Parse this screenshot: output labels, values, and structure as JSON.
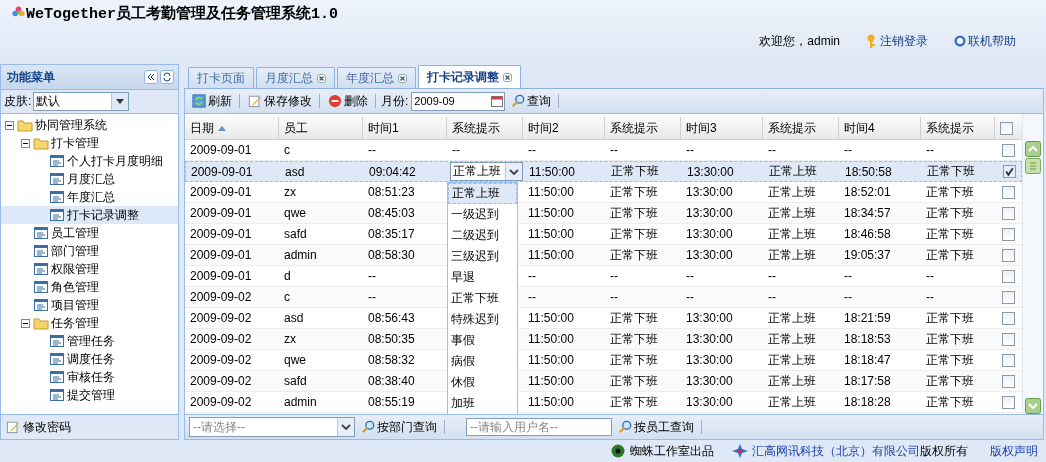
{
  "header": {
    "title": "WeTogether员工考勤管理及任务管理系统1.0",
    "welcome": "欢迎您，admin",
    "links": [
      "注销登录",
      "联机帮助"
    ]
  },
  "sidebar": {
    "title": "功能菜单",
    "skin_label": "皮肤:",
    "skin_value": "默认",
    "tree": [
      {
        "label": "协同管理系统",
        "expanded": true,
        "selected": false,
        "children": [
          {
            "label": "打卡管理",
            "expanded": true,
            "selected": false,
            "children": [
              {
                "label": "个人打卡月度明细",
                "selected": false
              },
              {
                "label": "月度汇总",
                "selected": false
              },
              {
                "label": "年度汇总",
                "selected": false
              },
              {
                "label": "打卡记录调整",
                "selected": true
              }
            ]
          },
          {
            "label": "员工管理",
            "selected": false
          },
          {
            "label": "部门管理",
            "selected": false
          },
          {
            "label": "权限管理",
            "selected": false
          },
          {
            "label": "角色管理",
            "selected": false
          },
          {
            "label": "项目管理",
            "selected": false
          },
          {
            "label": "任务管理",
            "expanded": true,
            "selected": false,
            "children": [
              {
                "label": "管理任务",
                "selected": false
              },
              {
                "label": "调度任务",
                "selected": false
              },
              {
                "label": "审核任务",
                "selected": false
              },
              {
                "label": "提交管理",
                "selected": false
              }
            ]
          }
        ]
      }
    ],
    "footer_button": "修改密码"
  },
  "tabs": [
    {
      "label": "打卡页面",
      "closable": false,
      "selected": false
    },
    {
      "label": "月度汇总",
      "closable": true,
      "selected": false
    },
    {
      "label": "年度汇总",
      "closable": true,
      "selected": false
    },
    {
      "label": "打卡记录调整",
      "closable": true,
      "selected": true
    }
  ],
  "toolbar": {
    "refresh": "刷新",
    "save": "保存修改",
    "delete": "删除",
    "month_label": "月份:",
    "month_value": "2009-09",
    "search": "查询"
  },
  "table": {
    "columns": [
      {
        "label": "日期",
        "sorted": true
      },
      {
        "label": "员工",
        "sorted": false
      },
      {
        "label": "时间1",
        "sorted": false
      },
      {
        "label": "系统提示",
        "sorted": false
      },
      {
        "label": "时间2",
        "sorted": false
      },
      {
        "label": "系统提示",
        "sorted": false
      },
      {
        "label": "时间3",
        "sorted": false
      },
      {
        "label": "系统提示",
        "sorted": false
      },
      {
        "label": "时间4",
        "sorted": false
      },
      {
        "label": "系统提示",
        "sorted": false
      }
    ],
    "header_checked": false,
    "rows": [
      {
        "cells": [
          "2009-09-01",
          "c",
          "--",
          "--",
          "--",
          "--",
          "--",
          "--",
          "--",
          "--"
        ],
        "selected": false,
        "checked": false
      },
      {
        "cells": [
          "2009-09-01",
          "asd",
          "09:04:42",
          null,
          "11:50:00",
          "正常下班",
          "13:30:00",
          "正常上班",
          "18:50:58",
          "正常下班"
        ],
        "editor": "正常上班",
        "selected": true,
        "checked": true
      },
      {
        "cells": [
          "2009-09-01",
          "zx",
          "08:51:23",
          null,
          "11:50:00",
          "正常下班",
          "13:30:00",
          "正常上班",
          "18:52:01",
          "正常下班"
        ],
        "selected": false,
        "checked": false
      },
      {
        "cells": [
          "2009-09-01",
          "qwe",
          "08:45:03",
          null,
          "11:50:00",
          "正常下班",
          "13:30:00",
          "正常上班",
          "18:34:57",
          "正常下班"
        ],
        "selected": false,
        "checked": false
      },
      {
        "cells": [
          "2009-09-01",
          "safd",
          "08:35:17",
          null,
          "11:50:00",
          "正常下班",
          "13:30:00",
          "正常上班",
          "18:46:58",
          "正常下班"
        ],
        "selected": false,
        "checked": false
      },
      {
        "cells": [
          "2009-09-01",
          "admin",
          "08:58:30",
          null,
          "11:50:00",
          "正常下班",
          "13:30:00",
          "正常上班",
          "19:05:37",
          "正常下班"
        ],
        "selected": false,
        "checked": false
      },
      {
        "cells": [
          "2009-09-01",
          "d",
          "--",
          null,
          "--",
          "--",
          "--",
          "--",
          "--",
          "--"
        ],
        "selected": false,
        "checked": false
      },
      {
        "cells": [
          "2009-09-02",
          "c",
          "--",
          null,
          "--",
          "--",
          "--",
          "--",
          "--",
          "--"
        ],
        "selected": false,
        "checked": false
      },
      {
        "cells": [
          "2009-09-02",
          "asd",
          "08:56:43",
          null,
          "11:50:00",
          "正常下班",
          "13:30:00",
          "正常上班",
          "18:21:59",
          "正常下班"
        ],
        "selected": false,
        "checked": false
      },
      {
        "cells": [
          "2009-09-02",
          "zx",
          "08:50:35",
          null,
          "11:50:00",
          "正常下班",
          "13:30:00",
          "正常上班",
          "18:18:53",
          "正常下班"
        ],
        "selected": false,
        "checked": false
      },
      {
        "cells": [
          "2009-09-02",
          "qwe",
          "08:58:32",
          null,
          "11:50:00",
          "正常下班",
          "13:30:00",
          "正常上班",
          "18:18:47",
          "正常下班"
        ],
        "selected": false,
        "checked": false
      },
      {
        "cells": [
          "2009-09-02",
          "safd",
          "08:38:40",
          null,
          "11:50:00",
          "正常下班",
          "13:30:00",
          "正常上班",
          "18:17:58",
          "正常下班"
        ],
        "selected": false,
        "checked": false
      },
      {
        "cells": [
          "2009-09-02",
          "admin",
          "08:55:19",
          null,
          "11:50:00",
          "正常下班",
          "13:30:00",
          "正常上班",
          "18:18:28",
          "正常下班"
        ],
        "selected": false,
        "checked": false
      }
    ],
    "dropdown": [
      {
        "label": "正常上班",
        "selected": true
      },
      {
        "label": "一级迟到",
        "selected": false
      },
      {
        "label": "二级迟到",
        "selected": false
      },
      {
        "label": "三级迟到",
        "selected": false
      },
      {
        "label": "早退",
        "selected": false
      },
      {
        "label": "正常下班",
        "selected": false
      },
      {
        "label": "特殊迟到",
        "selected": false
      },
      {
        "label": "事假",
        "selected": false
      },
      {
        "label": "病假",
        "selected": false
      },
      {
        "label": "休假",
        "selected": false
      },
      {
        "label": "加班",
        "selected": false
      }
    ]
  },
  "bottom_bar": {
    "dept_placeholder": "--请选择--",
    "dept_search": "按部门查询",
    "user_placeholder": "--请输入用户名--",
    "user_search": "按员工查询"
  },
  "footer": {
    "studio": "蜘蛛工作室出品",
    "company": "汇高网讯科技（北京）有限公司",
    "rights": "版权所有",
    "statement": "版权声明"
  }
}
